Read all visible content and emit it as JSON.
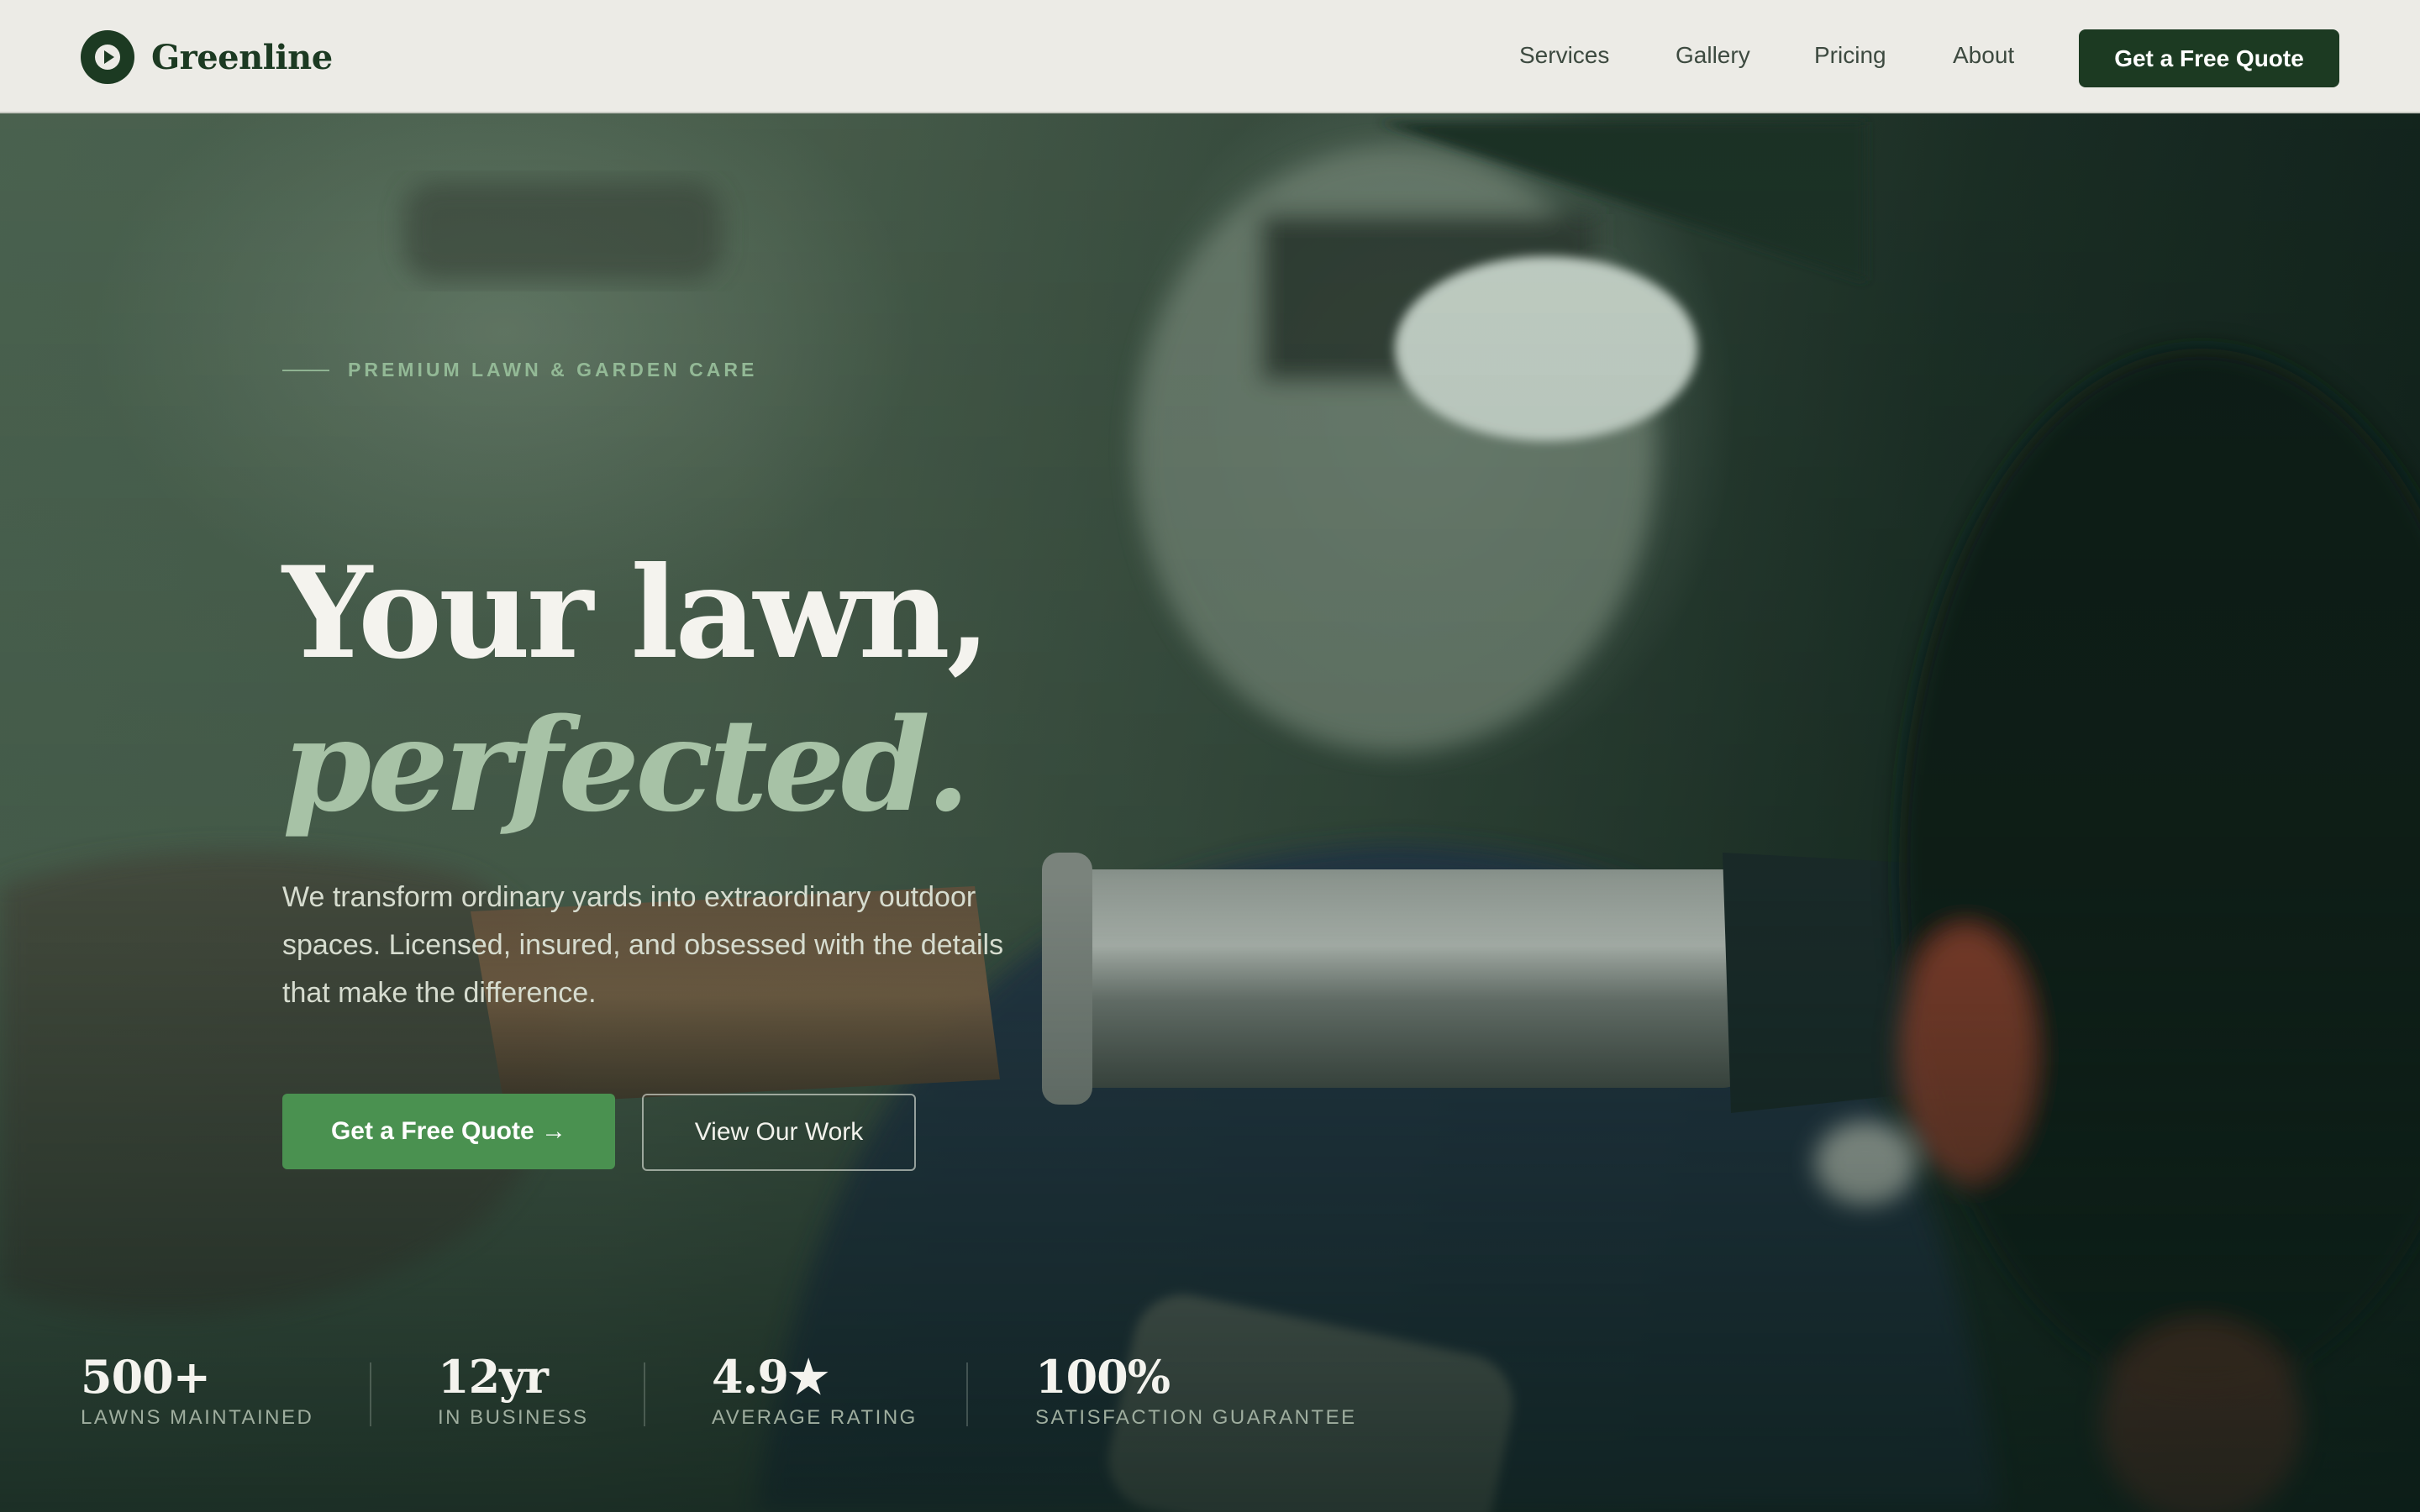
{
  "nav": {
    "brand": "Greenline",
    "links": [
      "Services",
      "Gallery",
      "Pricing",
      "About"
    ],
    "cta": "Get a Free Quote"
  },
  "hero": {
    "eyebrow": "PREMIUM LAWN & GARDEN CARE",
    "headline_line1": "Your lawn,",
    "headline_line2": "perfected.",
    "subcopy": "We transform ordinary yards into extraordinary outdoor spaces. Licensed, insured, and obsessed with the details that make the difference.",
    "primary_cta": "Get a Free Quote →",
    "secondary_cta": "View Our Work"
  },
  "stats": [
    {
      "value": "500+",
      "label": "LAWNS MAINTAINED"
    },
    {
      "value": "12yr",
      "label": "IN BUSINESS"
    },
    {
      "value": "4.9★",
      "label": "AVERAGE RATING"
    },
    {
      "value": "100%",
      "label": "SATISFACTION GUARANTEE"
    }
  ],
  "colors": {
    "brand_dark": "#1c3a22",
    "accent_green": "#4a9150",
    "headline_accent": "#a7c2a6",
    "nav_bg": "#ecebe6"
  },
  "icons": {
    "brand_mark": "play-circle-icon"
  }
}
